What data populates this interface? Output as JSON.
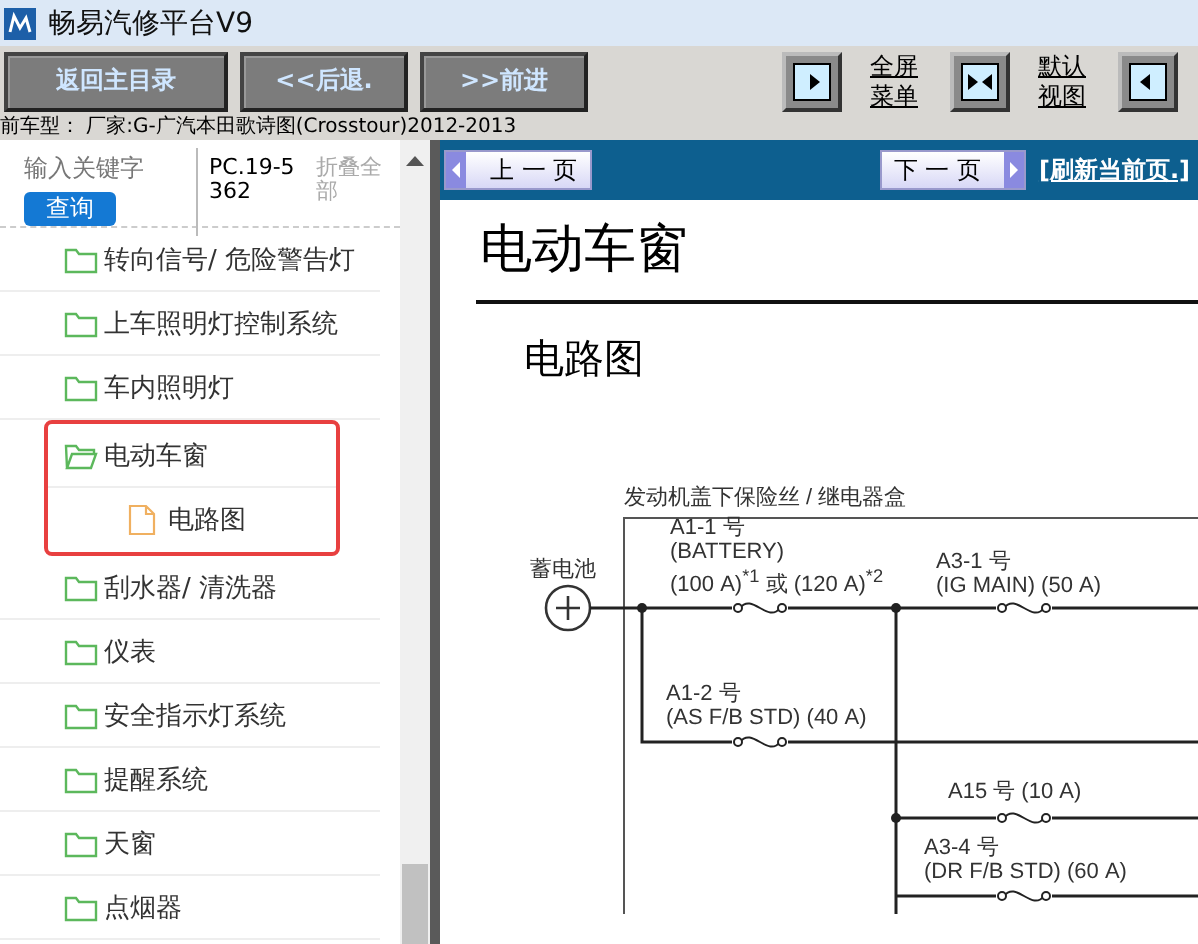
{
  "window": {
    "title": "畅易汽修平台V9"
  },
  "toolbar": {
    "buttons": [
      "返回主目录",
      "<<后退.",
      ">>前进"
    ],
    "view_links": [
      {
        "label": "全屏菜单"
      },
      {
        "label": "默认视图"
      }
    ]
  },
  "vehicle_info": "前车型： 厂家:G-广汽本田歌诗图(Crosstour)2012-2013",
  "search": {
    "placeholder": "输入关键字",
    "button": "查询",
    "code": "PC.19-5362",
    "collapse": "折叠全部"
  },
  "tree": [
    {
      "label": "转向信号/ 危险警告灯",
      "expanded": false,
      "highlighted": false
    },
    {
      "label": "上车照明灯控制系统",
      "expanded": false,
      "highlighted": false
    },
    {
      "label": "车内照明灯",
      "expanded": false,
      "highlighted": false
    },
    {
      "label": "电动车窗",
      "expanded": true,
      "highlighted": true,
      "children": [
        {
          "label": "电路图"
        }
      ]
    },
    {
      "label": "刮水器/ 清洗器",
      "expanded": false,
      "highlighted": false
    },
    {
      "label": "仪表",
      "expanded": false,
      "highlighted": false
    },
    {
      "label": "安全指示灯系统",
      "expanded": false,
      "highlighted": false
    },
    {
      "label": "提醒系统",
      "expanded": false,
      "highlighted": false
    },
    {
      "label": "天窗",
      "expanded": false,
      "highlighted": false
    },
    {
      "label": "点烟器",
      "expanded": false,
      "highlighted": false
    }
  ],
  "pager": {
    "prev": "上 一 页",
    "next": "下 一 页",
    "refresh": "[刷新当前页.]"
  },
  "document": {
    "title": "电动车窗",
    "section": "电路图",
    "diagram": {
      "box_label": "发动机盖下保险丝 / 继电器盒",
      "battery_label": "蓄电池",
      "fuses": [
        {
          "lines": [
            "A1-1 号",
            "(BATTERY)",
            "(100 A)$^{*1}$ 或 (120 A)$^{*2}$"
          ]
        },
        {
          "lines": [
            "A3-1 号",
            "(IG MAIN) (50 A)"
          ]
        },
        {
          "lines": [
            "A1-2 号",
            "(AS F/B STD) (40 A)"
          ]
        },
        {
          "lines": [
            "A15 号 (10 A)"
          ]
        },
        {
          "lines": [
            "A3-4 号",
            "(DR F/B STD) (60 A)"
          ]
        }
      ]
    }
  }
}
